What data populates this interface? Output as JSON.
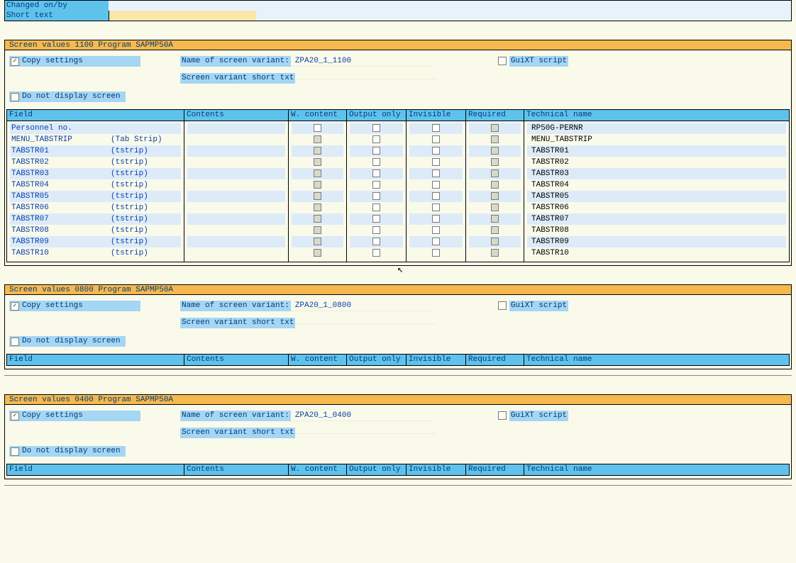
{
  "top": {
    "changed_on_by": "Changed on/by",
    "short_text": "Short text"
  },
  "columns": {
    "field": "Field",
    "contents": "Contents",
    "wcontent": "W. content",
    "output_only": "Output only",
    "invisible": "Invisible",
    "required": "Required",
    "technical_name": "Technical name"
  },
  "labels": {
    "copy_settings": "Copy settings",
    "do_not_display": "Do not display screen",
    "name_of_variant": "Name of screen variant:",
    "variant_short_txt": "Screen variant short txt",
    "guixt": "GuiXT script"
  },
  "sections": [
    {
      "header": "Screen values   1100 Program  SAPMP50A",
      "variant_name": "ZPA20_1_1100",
      "copy_checked": true,
      "guixt_checked": false,
      "dnd_checked": false,
      "rows": [
        {
          "field": "Personnel no.",
          "note": "",
          "tech": "RP50G-PERNR",
          "enabled": true
        },
        {
          "field": "MENU_TABSTRIP",
          "note": "(Tab Strip)",
          "tech": "MENU_TABSTRIP",
          "enabled": false
        },
        {
          "field": "TABSTR01",
          "note": "(tstrip)",
          "tech": "TABSTR01",
          "enabled": false
        },
        {
          "field": "TABSTR02",
          "note": "(tstrip)",
          "tech": "TABSTR02",
          "enabled": false
        },
        {
          "field": "TABSTR03",
          "note": "(tstrip)",
          "tech": "TABSTR03",
          "enabled": false
        },
        {
          "field": "TABSTR04",
          "note": "(tstrip)",
          "tech": "TABSTR04",
          "enabled": false
        },
        {
          "field": "TABSTR05",
          "note": "(tstrip)",
          "tech": "TABSTR05",
          "enabled": false
        },
        {
          "field": "TABSTR06",
          "note": "(tstrip)",
          "tech": "TABSTR06",
          "enabled": false
        },
        {
          "field": "TABSTR07",
          "note": "(tstrip)",
          "tech": "TABSTR07",
          "enabled": false
        },
        {
          "field": "TABSTR08",
          "note": "(tstrip)",
          "tech": "TABSTR08",
          "enabled": false
        },
        {
          "field": "TABSTR09",
          "note": "(tstrip)",
          "tech": "TABSTR09",
          "enabled": false
        },
        {
          "field": "TABSTR10",
          "note": "(tstrip)",
          "tech": "TABSTR10",
          "enabled": false
        }
      ]
    },
    {
      "header": "Screen values   0800 Program  SAPMP50A",
      "variant_name": "ZPA20_1_0800",
      "copy_checked": true,
      "guixt_checked": false,
      "dnd_checked": false,
      "rows": []
    },
    {
      "header": "Screen values   0400 Program  SAPMP50A",
      "variant_name": "ZPA20_1_0400",
      "copy_checked": true,
      "guixt_checked": false,
      "dnd_checked": false,
      "rows": []
    }
  ]
}
